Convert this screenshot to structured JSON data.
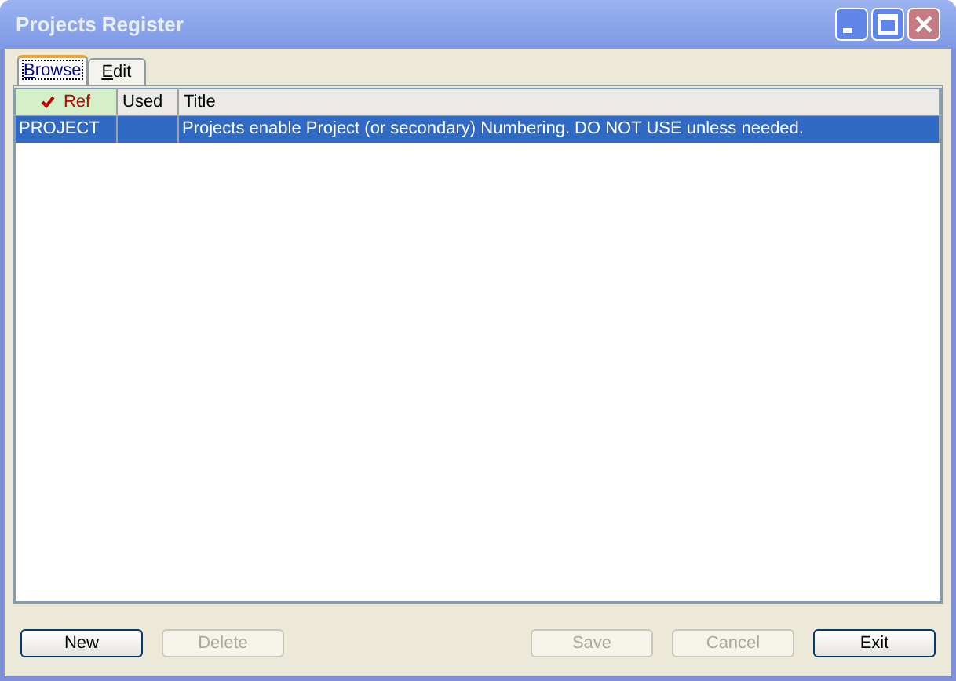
{
  "window": {
    "title": "Projects Register"
  },
  "tabs": [
    {
      "label": "Browse",
      "selected": true
    },
    {
      "label": "Edit",
      "selected": false
    }
  ],
  "table": {
    "columns": [
      {
        "label": "Ref",
        "sorted": true
      },
      {
        "label": "Used",
        "sorted": false
      },
      {
        "label": "Title",
        "sorted": false
      }
    ],
    "rows": [
      {
        "cells": [
          "PROJECT",
          "",
          "Projects enable Project (or secondary) Numbering. DO NOT USE unless needed."
        ],
        "selected": true
      }
    ]
  },
  "buttons": [
    {
      "label": "New",
      "disabled": false
    },
    {
      "label": "Delete",
      "disabled": true
    },
    {
      "label": "Save",
      "disabled": true
    },
    {
      "label": "Cancel",
      "disabled": true
    },
    {
      "label": "Exit",
      "disabled": false
    }
  ]
}
